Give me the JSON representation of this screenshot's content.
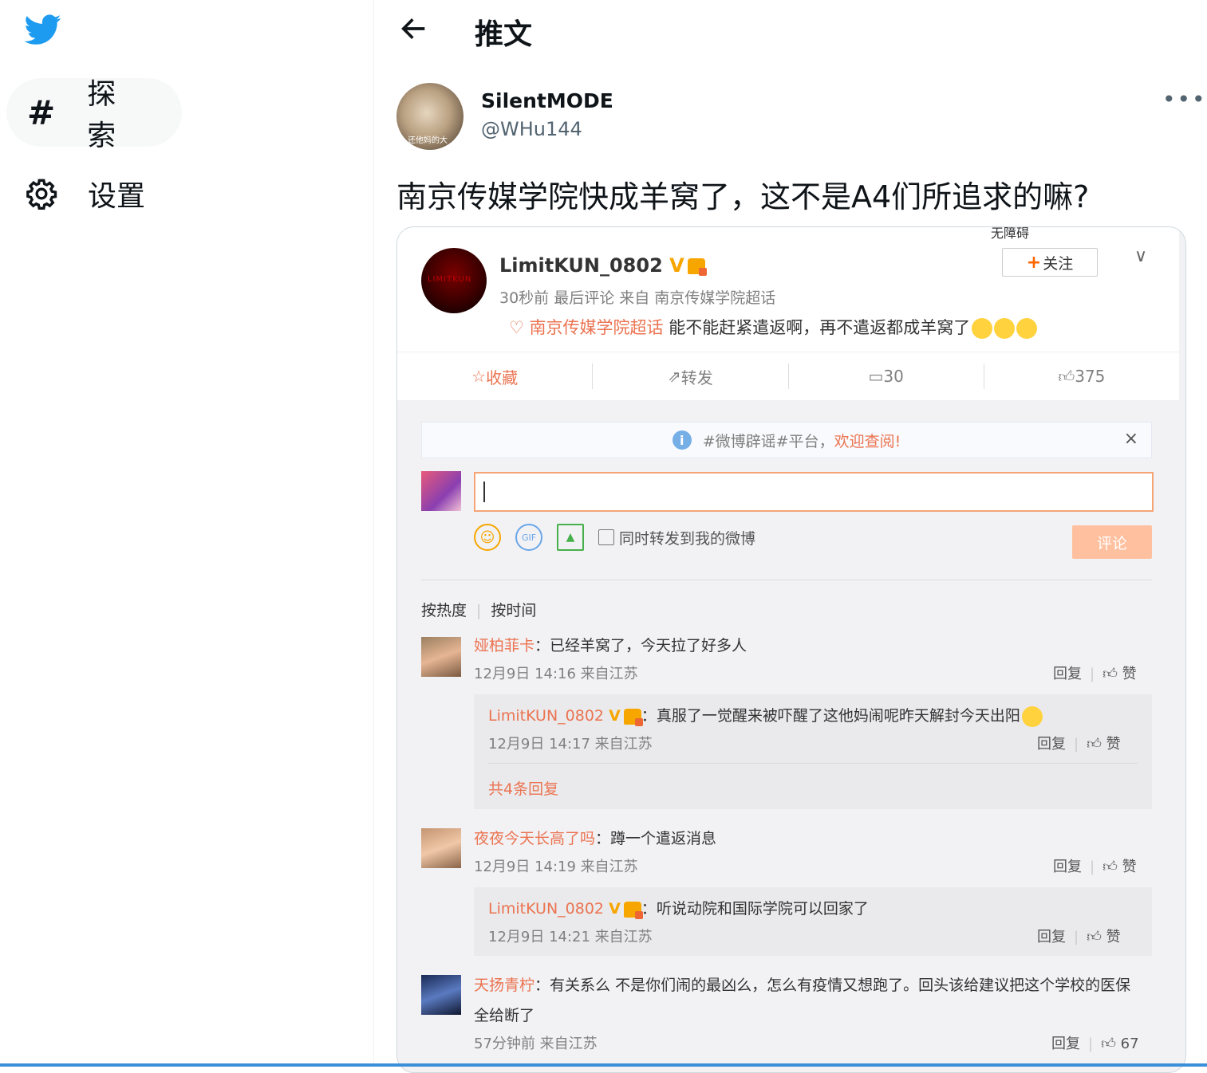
{
  "nav": {
    "explore_label": "探索",
    "settings_label": "设置",
    "explore_icon": "#"
  },
  "header": {
    "title": "推文"
  },
  "tweet": {
    "author_name": "SilentMODE",
    "author_handle": "@WHu144",
    "avatar_caption": "还他妈的大",
    "text": "南京传媒学院快成羊窝了，这不是A4们所追求的嘛?"
  },
  "weibo": {
    "header_cut_text": "无障碍",
    "author": "LimitKUN_0802",
    "meta": "30秒前 最后评论 来自 南京传媒学院超话",
    "avatar_text": "LIMITKUN",
    "topic": "南京传媒学院超话",
    "body": "能不能赶紧遣返啊，再不遣返都成羊窝了",
    "follow_label": "关注",
    "actions": {
      "fav": "收藏",
      "repost": "转发",
      "comments": "30",
      "likes": "375"
    },
    "notice": {
      "prefix": "#微博辟谣#平台，",
      "link": "欢迎查阅!"
    },
    "tools": {
      "sync_label": "同时转发到我的微博",
      "submit_label": "评论",
      "gif": "GIF"
    },
    "sort": {
      "hot": "按热度",
      "time": "按时间"
    },
    "comments": [
      {
        "name": "娅柏菲卡",
        "text": "已经羊窝了，今天拉了好多人",
        "time": "12月9日 14:16 来自江苏",
        "reply": "回复",
        "like": "赞"
      },
      {
        "name": "夜夜今天长高了吗",
        "text": "蹲一个遣返消息",
        "time": "12月9日 14:19 来自江苏",
        "reply": "回复",
        "like": "赞"
      },
      {
        "name": "天扬青柠",
        "text": "有关系么 不是你们闹的最凶么，怎么有疫情又想跑了。回头该给建议把这个学校的医保",
        "text2": "全给断了",
        "time": "57分钟前 来自江苏",
        "reply": "回复",
        "like": "67"
      }
    ],
    "replies": [
      {
        "name": "LimitKUN_0802",
        "text": "真服了一觉醒来被吓醒了这他妈闹呢昨天解封今天出阳",
        "time": "12月9日 14:17 来自江苏",
        "reply": "回复",
        "like": "赞"
      },
      {
        "name": "LimitKUN_0802",
        "text": "听说动院和国际学院可以回家了",
        "time": "12月9日 14:21 来自江苏",
        "reply": "回复",
        "like": "赞"
      }
    ],
    "more_replies": "共4条回复"
  }
}
